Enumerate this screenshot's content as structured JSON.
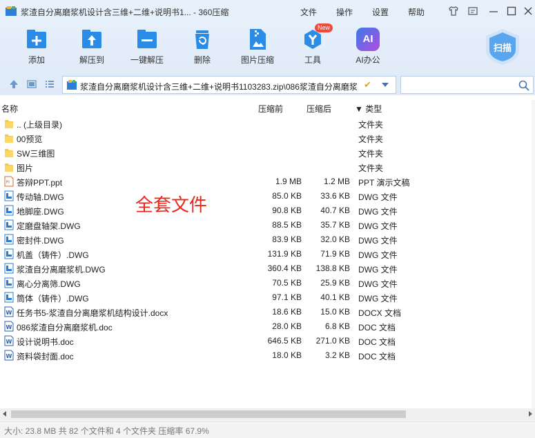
{
  "window": {
    "title": "浆渣自分离磨浆机设计含三维+二维+说明书1... - 360压缩",
    "menu": [
      "文件",
      "操作",
      "设置",
      "帮助"
    ]
  },
  "toolbar": {
    "items": [
      {
        "label": "添加",
        "icon": "add-icon"
      },
      {
        "label": "解压到",
        "icon": "extract-to-icon"
      },
      {
        "label": "一键解压",
        "icon": "one-click-extract-icon"
      },
      {
        "label": "删除",
        "icon": "trash-icon"
      },
      {
        "label": "图片压缩",
        "icon": "image-compress-icon"
      },
      {
        "label": "工具",
        "icon": "tools-icon",
        "badge": "New"
      },
      {
        "label": "AI办公",
        "icon": "ai-office-icon",
        "icon_text": "AI"
      }
    ],
    "scan_label": "扫描"
  },
  "pathbar": {
    "path": "浆渣自分离磨浆机设计含三维+二维+说明书1103283.zip\\086浆渣自分离磨浆",
    "search_placeholder": ""
  },
  "columns": {
    "name": "名称",
    "size": "压缩前",
    "compressed": "压缩后",
    "type": "▼ 类型"
  },
  "files": [
    {
      "name": ".. (上级目录)",
      "size": "",
      "compressed": "",
      "type": "文件夹",
      "icon": "folder-icon"
    },
    {
      "name": "00预览",
      "size": "",
      "compressed": "",
      "type": "文件夹",
      "icon": "folder-icon"
    },
    {
      "name": "SW三维图",
      "size": "",
      "compressed": "",
      "type": "文件夹",
      "icon": "folder-icon"
    },
    {
      "name": "图片",
      "size": "",
      "compressed": "",
      "type": "文件夹",
      "icon": "folder-icon"
    },
    {
      "name": "答辩PPT.ppt",
      "size": "1.9 MB",
      "compressed": "1.2 MB",
      "type": "PPT 演示文稿",
      "icon": "ppt-file-icon"
    },
    {
      "name": "传动轴.DWG",
      "size": "85.0 KB",
      "compressed": "33.6 KB",
      "type": "DWG 文件",
      "icon": "dwg-file-icon"
    },
    {
      "name": "地脚座.DWG",
      "size": "90.8 KB",
      "compressed": "40.7 KB",
      "type": "DWG 文件",
      "icon": "dwg-file-icon"
    },
    {
      "name": "定磨盘轴架.DWG",
      "size": "88.5 KB",
      "compressed": "35.7 KB",
      "type": "DWG 文件",
      "icon": "dwg-file-icon"
    },
    {
      "name": "密封件.DWG",
      "size": "83.9 KB",
      "compressed": "32.0 KB",
      "type": "DWG 文件",
      "icon": "dwg-file-icon"
    },
    {
      "name": "机盖（铸件）.DWG",
      "size": "131.9 KB",
      "compressed": "71.9 KB",
      "type": "DWG 文件",
      "icon": "dwg-file-icon"
    },
    {
      "name": "浆渣自分离磨浆机.DWG",
      "size": "360.4 KB",
      "compressed": "138.8 KB",
      "type": "DWG 文件",
      "icon": "dwg-file-icon"
    },
    {
      "name": "离心分离筛.DWG",
      "size": "70.5 KB",
      "compressed": "25.9 KB",
      "type": "DWG 文件",
      "icon": "dwg-file-icon"
    },
    {
      "name": "筒体（铸件）.DWG",
      "size": "97.1 KB",
      "compressed": "40.1 KB",
      "type": "DWG 文件",
      "icon": "dwg-file-icon"
    },
    {
      "name": "任务书5-浆渣自分离磨浆机结构设计.docx",
      "size": "18.6 KB",
      "compressed": "15.0 KB",
      "type": "DOCX 文档",
      "icon": "word-file-icon"
    },
    {
      "name": "086浆渣自分离磨浆机.doc",
      "size": "28.0 KB",
      "compressed": "6.8 KB",
      "type": "DOC 文档",
      "icon": "word-file-icon"
    },
    {
      "name": "设计说明书.doc",
      "size": "646.5 KB",
      "compressed": "271.0 KB",
      "type": "DOC 文档",
      "icon": "word-file-icon"
    },
    {
      "name": "资料袋封面.doc",
      "size": "18.0 KB",
      "compressed": "3.2 KB",
      "type": "DOC 文档",
      "icon": "word-file-icon"
    }
  ],
  "annotation": "全套文件",
  "status": "大小: 23.8 MB 共 82 个文件和 4 个文件夹 压缩率 67.9%",
  "colors": {
    "toolbar_bg": "#e3edf9",
    "icon_blue": "#2a8ce6",
    "annotation_red": "#e8271b",
    "folder_yellow": "#f7c94a"
  }
}
